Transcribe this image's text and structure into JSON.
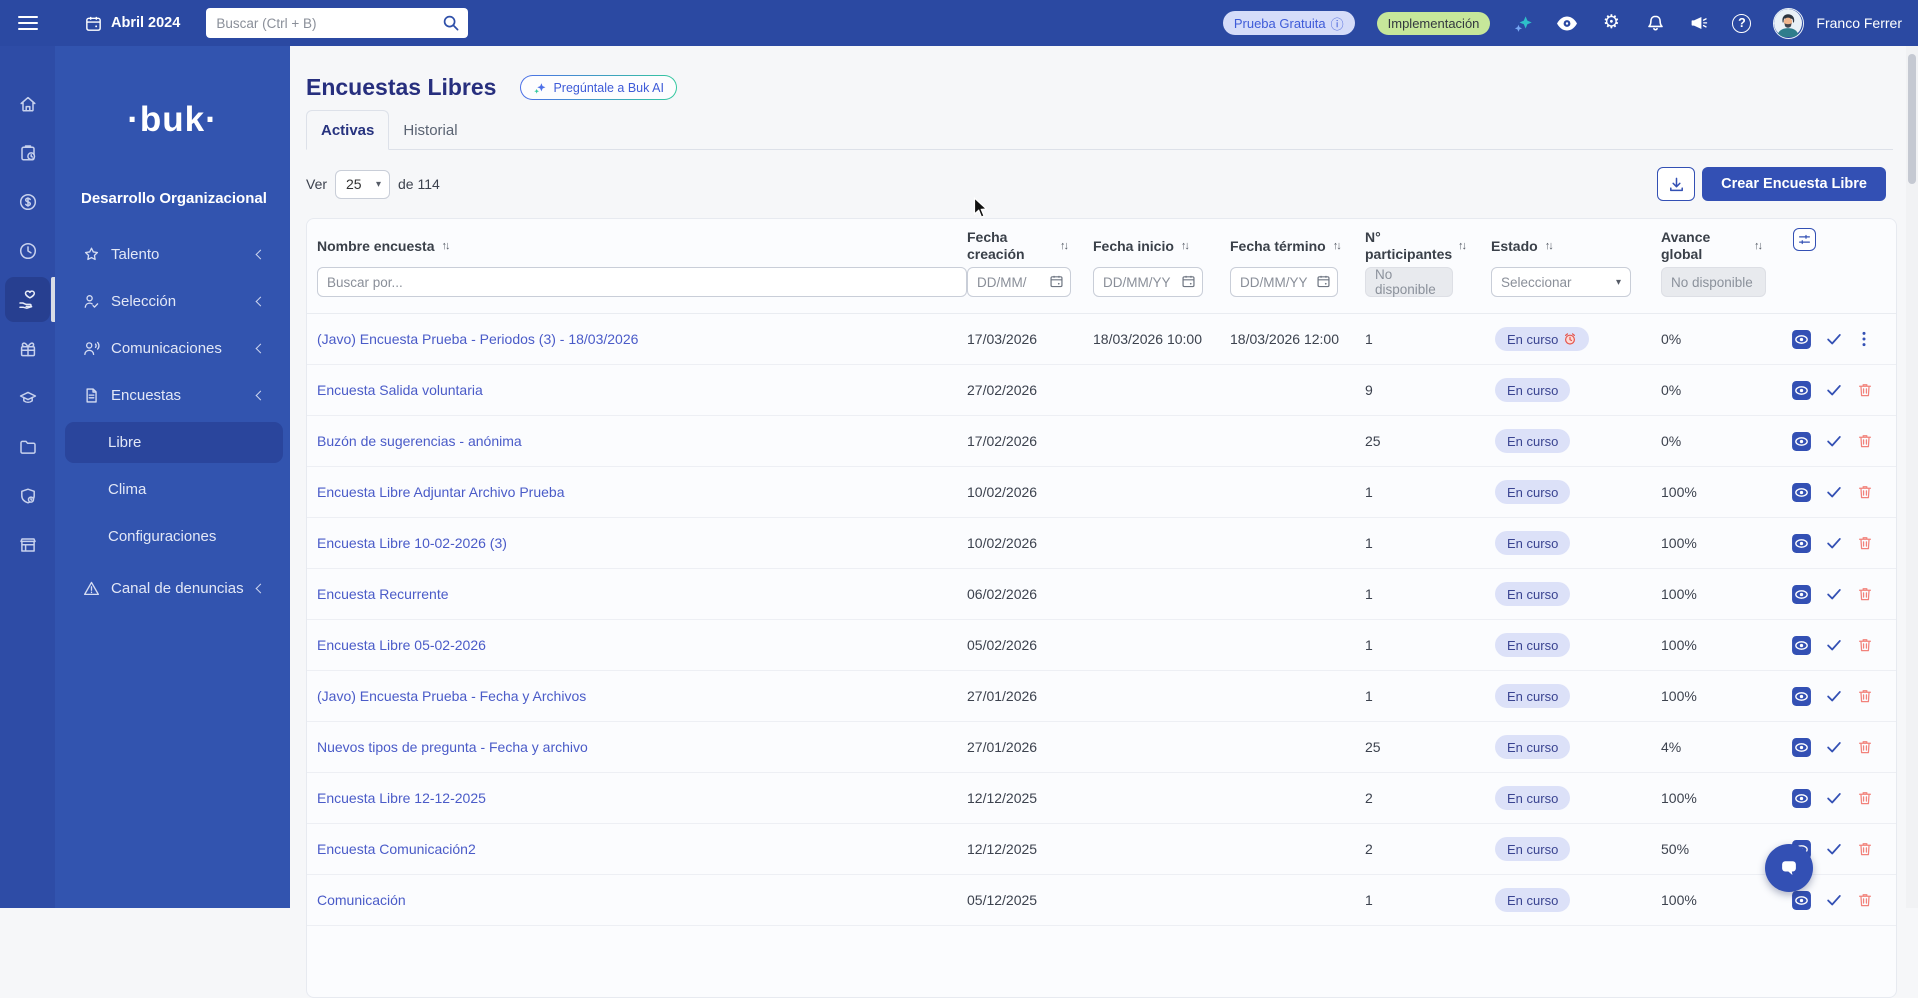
{
  "navbar": {
    "date": "Abril 2024",
    "search_placeholder": "Buscar (Ctrl + B)",
    "trial_badge": "Prueba Gratuita",
    "implementation_badge": "Implementación",
    "user_name": "Franco Ferrer",
    "icons": [
      "hamburger-icon",
      "calendar-icon",
      "search-icon",
      "info-icon",
      "sparkle-icon",
      "eye-icon",
      "gear-icon",
      "bell-icon",
      "megaphone-icon",
      "help-icon",
      "avatar"
    ]
  },
  "icons": {
    "sort": "↑↓",
    "info": "ⓘ",
    "gear": "⚙",
    "help": "?",
    "caret": "▾"
  },
  "sidebar": {
    "logo": "·buk·",
    "section_title": "Desarrollo Organizacional",
    "rail_icons": [
      "home-icon",
      "clipboard-clock-icon",
      "dollar-icon",
      "clock-icon",
      "hand-heart-icon",
      "gift-icon",
      "graduation-cap-icon",
      "folder-icon",
      "shield-icon",
      "store-icon"
    ],
    "rail_active_index": 4,
    "items": [
      {
        "label": "Talento",
        "icon": "star-icon"
      },
      {
        "label": "Selección",
        "icon": "person-check-icon"
      },
      {
        "label": "Comunicaciones",
        "icon": "person-megaphone-icon"
      },
      {
        "label": "Encuestas",
        "icon": "document-icon"
      }
    ],
    "sub_items": [
      {
        "label": "Libre",
        "active": true
      },
      {
        "label": "Clima",
        "active": false
      },
      {
        "label": "Configuraciones",
        "active": false
      }
    ],
    "bottom_item": {
      "label": "Canal de denuncias",
      "icon": "warning-triangle-icon"
    }
  },
  "page": {
    "title": "Encuestas Libres",
    "ai_button": "Pregúntale a Buk AI",
    "tabs": [
      "Activas",
      "Historial"
    ],
    "pagination": {
      "ver_label": "Ver",
      "page_size": "25",
      "total_label": "de 114"
    },
    "create_button": "Crear Encuesta Libre"
  },
  "table": {
    "columns": [
      "Nombre encuesta",
      "Fecha creación",
      "Fecha inicio",
      "Fecha término",
      "N° participantes",
      "Estado",
      "Avance global"
    ],
    "filters": {
      "name_placeholder": "Buscar por...",
      "date_short_placeholder": "DD/MM/",
      "date_placeholder": "DD/MM/YY",
      "disabled_text": "No disponible",
      "select_placeholder": "Seleccionar"
    },
    "rows": [
      {
        "name": "(Javo) Encuesta Prueba - Periodos (3) - 18/03/2026",
        "created": "17/03/2026",
        "start": "18/03/2026 10:00",
        "end": "18/03/2026 12:00",
        "participants": "1",
        "status": "En curso",
        "alarm": true,
        "progress": "0%",
        "last_action": "kebab"
      },
      {
        "name": "Encuesta Salida voluntaria",
        "created": "27/02/2026",
        "start": "",
        "end": "",
        "participants": "9",
        "status": "En curso",
        "alarm": false,
        "progress": "0%",
        "last_action": "trash"
      },
      {
        "name": "Buzón de sugerencias - anónima",
        "created": "17/02/2026",
        "start": "",
        "end": "",
        "participants": "25",
        "status": "En curso",
        "alarm": false,
        "progress": "0%",
        "last_action": "trash"
      },
      {
        "name": "Encuesta Libre Adjuntar Archivo Prueba",
        "created": "10/02/2026",
        "start": "",
        "end": "",
        "participants": "1",
        "status": "En curso",
        "alarm": false,
        "progress": "100%",
        "last_action": "trash"
      },
      {
        "name": "Encuesta Libre 10-02-2026 (3)",
        "created": "10/02/2026",
        "start": "",
        "end": "",
        "participants": "1",
        "status": "En curso",
        "alarm": false,
        "progress": "100%",
        "last_action": "trash"
      },
      {
        "name": "Encuesta Recurrente",
        "created": "06/02/2026",
        "start": "",
        "end": "",
        "participants": "1",
        "status": "En curso",
        "alarm": false,
        "progress": "100%",
        "last_action": "trash"
      },
      {
        "name": "Encuesta Libre 05-02-2026",
        "created": "05/02/2026",
        "start": "",
        "end": "",
        "participants": "1",
        "status": "En curso",
        "alarm": false,
        "progress": "100%",
        "last_action": "trash"
      },
      {
        "name": "(Javo) Encuesta Prueba - Fecha y Archivos",
        "created": "27/01/2026",
        "start": "",
        "end": "",
        "participants": "1",
        "status": "En curso",
        "alarm": false,
        "progress": "100%",
        "last_action": "trash"
      },
      {
        "name": "Nuevos tipos de pregunta - Fecha y archivo",
        "created": "27/01/2026",
        "start": "",
        "end": "",
        "participants": "25",
        "status": "En curso",
        "alarm": false,
        "progress": "4%",
        "last_action": "trash"
      },
      {
        "name": "Encuesta Libre 12-12-2025",
        "created": "12/12/2025",
        "start": "",
        "end": "",
        "participants": "2",
        "status": "En curso",
        "alarm": false,
        "progress": "100%",
        "last_action": "trash"
      },
      {
        "name": "Encuesta Comunicación2",
        "created": "12/12/2025",
        "start": "",
        "end": "",
        "participants": "2",
        "status": "En curso",
        "alarm": false,
        "progress": "50%",
        "last_action": "trash"
      },
      {
        "name": "Comunicación",
        "created": "05/12/2025",
        "start": "",
        "end": "",
        "participants": "1",
        "status": "En curso",
        "alarm": false,
        "progress": "100%",
        "last_action": "trash"
      }
    ]
  },
  "colors": {
    "primary": "#3350B4",
    "navbar": "#2B49A2",
    "sidebar_rail": "#2E4CA6",
    "sidebar_panel": "#3254AF",
    "active_item": "#2A459C",
    "badge_bg": "#DCE1F8",
    "badge_text": "#3A4491",
    "link": "#4A5BC8",
    "danger": "#F2827B",
    "trial_badge_bg": "#D5DCF9",
    "implementation_badge_bg": "#C6E79A",
    "page_bg": "#F6F7F9"
  }
}
